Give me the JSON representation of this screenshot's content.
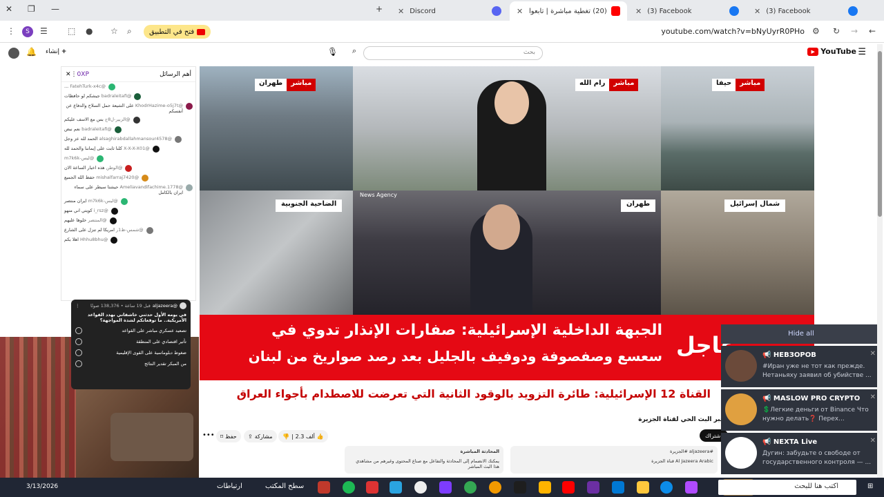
{
  "tabs": [
    {
      "label": "Discord",
      "color": "#5865f2"
    },
    {
      "label": "(20) تغطية مباشرة | تابعوا الت",
      "color": "#ff0000"
    },
    {
      "label": "(3) Facebook",
      "color": "#1877f2"
    },
    {
      "label": "(3) Facebook",
      "color": "#1877f2"
    }
  ],
  "address": {
    "url": "youtube.com/watch?v=bNyUyrR0PHo",
    "open_app": "فتح في التطبيق"
  },
  "youtube": {
    "logo": "YouTube",
    "search_placeholder": "بحث",
    "create_label": "إنشاء"
  },
  "chat": {
    "header_label": "أهم الرسائل",
    "points": "0XP",
    "messages": [
      {
        "name": "@FatehTurk-x4c",
        "text": "...",
        "color": "#2bb673"
      },
      {
        "name": "@badraleitafi",
        "text": "جيشكم لو حافظات",
        "color": "#1a5e3a"
      },
      {
        "name": "@KhodrHazime-o5j7t",
        "text": "على الشيعة حمل السلاح والدفاع عن أنفسكم",
        "color": "#8b1a4a"
      },
      {
        "name": "@الزبير-ل8ج",
        "text": "بس مع الاسف عليكم",
        "color": "#333"
      },
      {
        "name": "@badraleitafi",
        "text": "نعم نبض",
        "color": "#1a5e3a"
      },
      {
        "name": "@alsaghirabdallahmansour4578",
        "text": "الحمد لله عز وجل",
        "color": "#777"
      },
      {
        "name": "@X-X-X-X01",
        "text": "كلنا ثابت على إيماننا والحمد لله",
        "color": "#111"
      },
      {
        "name": "@ليس-m7k6k",
        "text": "",
        "color": "#2bb673"
      },
      {
        "name": "@الوطن",
        "text": "هذه اخبار الساعة الان",
        "color": "#c81e1e"
      },
      {
        "name": "@mishalfarraj7420",
        "text": "حفظ الله الجميع",
        "color": "#d68b1a"
      },
      {
        "name": "@Ameliavandifachime.1778",
        "text": "حيشتا سيطر على سماء ايران بالكامل",
        "color": "#9aa"
      },
      {
        "name": "@ليس-m7k6k",
        "text": "ايران منتصر",
        "color": "#2bb673"
      },
      {
        "name": "@i_rsz",
        "text": "كويتي اني منهو",
        "color": "#111"
      },
      {
        "name": "@المنتصر",
        "text": "خلوها عليهم",
        "color": "#111"
      },
      {
        "name": "@شمس-ظ1ر",
        "text": "امريكا لم تنزل على الشارع",
        "color": "#777"
      },
      {
        "name": "@Hhhu8bhu",
        "text": "اهلا بكم",
        "color": "#111"
      }
    ]
  },
  "poll": {
    "channel": "@aljazeera",
    "meta": "قبل 19 ساعة • 138,376 صوتًا",
    "question": "في يومه الأول حدثني خاشقاني بهدد القواعد الأمريكية.. ما توقعاتكم لشدة المواجهة؟",
    "options": [
      "تصعيد عسكري مباشر على القواعد",
      "تأثير اقتصادي على المنطقة",
      "ضغوط دبلوماسية على القوى الإقليمية",
      "من المبكر تقدير النتائج"
    ]
  },
  "video": {
    "live_label": "مباشر",
    "locations": [
      "طهران",
      "رام الله",
      "حيفا"
    ],
    "lower_tags": [
      "الضاحية الجنوبية",
      "طهران",
      "شمال إسرائيل"
    ],
    "news_agency": "News Agency",
    "headline_line1": "الجبهة الداخلية الإسرائيلية: صفارات الإنذار تدوي في",
    "headline_line2": "سعسع وصفصوفة ودوفيف بالجليل بعد رصد صواريخ من لبنان",
    "urgent": "عاجل",
    "subticker": "القناة 12 الإسرائيلية: طائرة التزويد بالوقود الثانية التي تعرضت للاصطدام بأجواء العراق"
  },
  "below": {
    "title": "عبر البث الحي لقناة الجزيرة",
    "like_count": "2.3 ألف",
    "share": "مشاركة",
    "save": "حفظ",
    "subscribe": "اشتراك",
    "desc_left_title": "المحادثة المباشرة",
    "desc_left": "يمكنك الانضمام إلى المحادثة والتفاعل مع صناع المحتوى وغيرهم من مشاهدي هذا البث المباشر",
    "desc_right": "#aljazeera #الجزيرة",
    "desc_right2": "Al Jazeera Arabic قناة الجزيرة"
  },
  "notifications": {
    "hide_all": "Hide all",
    "items": [
      {
        "title": "📢 НЕВЗОРОВ",
        "text": "#Иран уже не тот как прежде. Нетаньяху заявил об убийстве ...",
        "color": "#6b4a3a"
      },
      {
        "title": "📢 MASLOW PRO CRYPTO",
        "text": "💲Легкие деньги от Binance Что нужно делать❓ Перех...",
        "color": "#e0a040"
      },
      {
        "title": "📢 NEXTA Live",
        "text": "Дугин: забудьте о свободе от государственного контроля — ...",
        "color": "#ffffff"
      }
    ]
  },
  "taskbar": {
    "search_placeholder": "اكتب هنا للبحث",
    "desktop": "سطح المكتب",
    "links": "ارتباطات",
    "date": "3/13/2026"
  }
}
